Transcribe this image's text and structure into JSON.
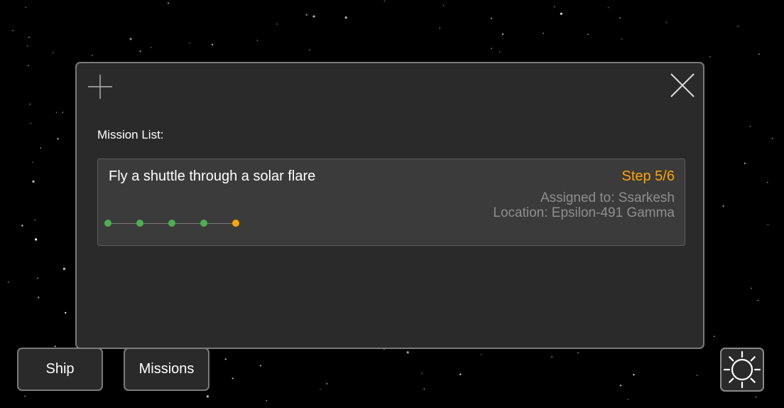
{
  "mission_panel": {
    "heading": "Mission List:",
    "missions": [
      {
        "title": "Fly a shuttle through a solar flare",
        "step": "Step 5/6",
        "assigned_to": "Assigned to: Ssarkesh",
        "location": "Location: Epsilon-491 Gamma",
        "progress_steps": [
          {
            "status": "complete"
          },
          {
            "status": "complete"
          },
          {
            "status": "complete"
          },
          {
            "status": "complete"
          },
          {
            "status": "current"
          }
        ]
      }
    ]
  },
  "nav": {
    "ship_label": "Ship",
    "missions_label": "Missions"
  },
  "icons": {
    "add": "plus-icon",
    "close": "close-icon",
    "brightness": "sun-icon"
  },
  "colors": {
    "complete": "#4caf50",
    "current": "#ffa500",
    "step_text": "#ffa500"
  }
}
